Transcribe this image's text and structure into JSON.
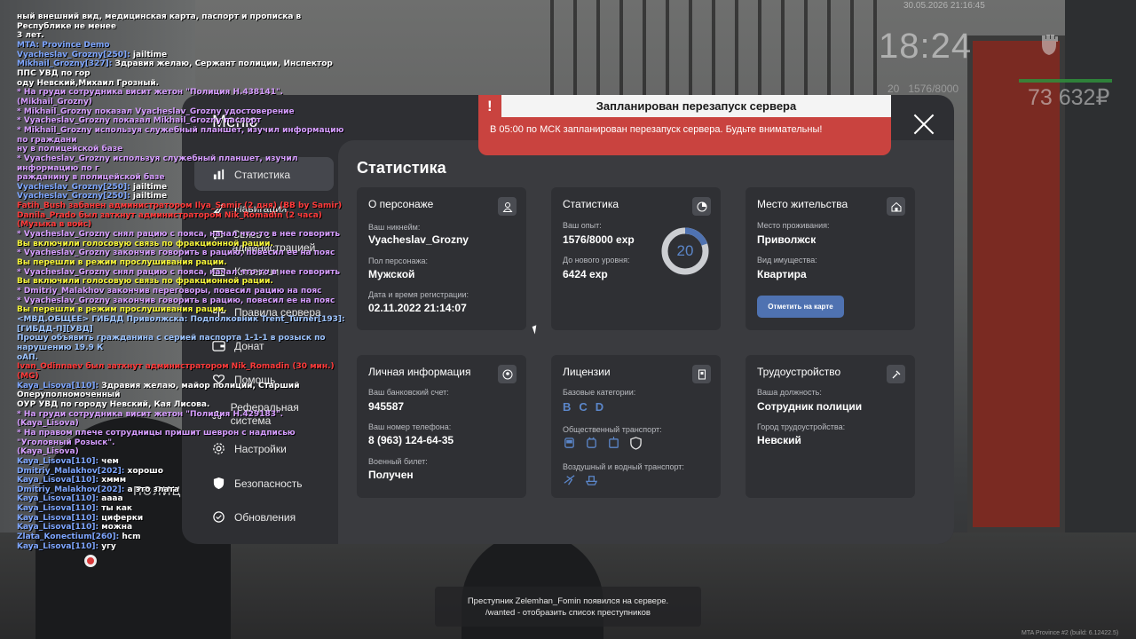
{
  "hud": {
    "date": "30.05.2026 21:16:45",
    "time": "18:24",
    "level": "20",
    "exp": "1576/8000",
    "money": "73 632₽"
  },
  "chat": [
    {
      "text": "ный внешний вид, медицинская карта, паспорт и прописка в Республике не менее",
      "color": "w"
    },
    {
      "text": "3 лет.",
      "color": "w"
    },
    {
      "text": "MTA: Province Demo",
      "color": "b"
    },
    {
      "text": "Vyacheslav_Grozny[250]: jailtime",
      "color": "b",
      "name": "Vyacheslav_Grozny[250]:",
      "msg": "jailtime"
    },
    {
      "text": "Mikhail_Grozny[327]: Здравия желаю, Сержант полиции, Инспектор ППС УВД по гор",
      "color": "b",
      "name": "Mikhail_Grozny[327]:",
      "msg": "Здравия желаю, Сержант полиции, Инспектор ППС УВД по гор"
    },
    {
      "text": "оду Невский,Михаил Грозный.",
      "color": "w"
    },
    {
      "text": "* На груди сотрудника висит жетон \"Полиция Н.438141\". (Mikhail_Grozny)",
      "color": "p"
    },
    {
      "text": "* Mikhail_Grozny показал Vyacheslav_Grozny удостоверение",
      "color": "p"
    },
    {
      "text": "* Vyacheslav_Grozny показал Mikhail_Grozny паспорт",
      "color": "p"
    },
    {
      "text": "* Mikhail_Grozny используя служебный планшет, изучил информацию по граждани",
      "color": "p"
    },
    {
      "text": "ну в полицейской базе",
      "color": "p"
    },
    {
      "text": "* Vyacheslav_Grozny используя служебный планшет, изучил информацию по г",
      "color": "p"
    },
    {
      "text": "ражданину в полицейской базе",
      "color": "p"
    },
    {
      "text": "Vyacheslav_Grozny[250]: jailtime",
      "color": "b",
      "name": "Vyacheslav_Grozny[250]:",
      "msg": "jailtime"
    },
    {
      "text": "Vyacheslav_Grozny[250]: jailtime",
      "color": "b",
      "name": "Vyacheslav_Grozny[250]:",
      "msg": "jailtime"
    },
    {
      "text": "Fatih_Bush забанен администратором Ilya_Samir (2 дня) (ВВ by Samir)",
      "color": "r"
    },
    {
      "text": "Danila_Prado был заткнут администратором Nik_Romadin (2 часа) (Музыка в войс)",
      "color": "r"
    },
    {
      "text": "* Vyacheslav_Grozny снял рацию с пояса, начал что-то в нее говорить",
      "color": "p"
    },
    {
      "text": "Вы включили голосовую связь по фракционной рации.",
      "color": "y"
    },
    {
      "text": "* Vyacheslav_Grozny закончив говорить в рацию, повесил ее на пояс",
      "color": "p"
    },
    {
      "text": "Вы перешли в режим прослушивания рации.",
      "color": "y"
    },
    {
      "text": "* Vyacheslav_Grozny снял рацию с пояса, начал что-то в нее говорить",
      "color": "p"
    },
    {
      "text": "Вы включили голосовую связь по фракционной рации.",
      "color": "y"
    },
    {
      "text": "* Dmitriy_Malakhov закончив переговоры, повесил рацию на пояс",
      "color": "p"
    },
    {
      "text": "* Vyacheslav_Grozny закончив говорить в рацию, повесил ее на пояс",
      "color": "p"
    },
    {
      "text": "Вы перешли в режим прослушивания рации.",
      "color": "y"
    },
    {
      "text": "<МВД.ОБЩЕЕ> ГИБДД Приволжска: Подполковник Trent_Turner[193]: [ГИБДД-П][УВД]",
      "color": "lb"
    },
    {
      "text": " Прошу объявить гражданина с серией паспорта 1-1-1 в розыск по нарушению 19.9 К",
      "color": "lb"
    },
    {
      "text": "оАП.",
      "color": "lb"
    },
    {
      "text": "Ivan_Odinnaev был заткнут администратором Nik_Romadin (30 мин.) (MG)",
      "color": "r"
    },
    {
      "text": "Kaya_Lisova[110]: Здравия желаю, майор полиции, Старший Оперуполномоченный",
      "color": "b",
      "name": "Kaya_Lisova[110]:",
      "msg": "Здравия желаю, майор полиции, Старший Оперуполномоченный"
    },
    {
      "text": " ОУР УВД по городу Невский, Кая Лисова.",
      "color": "w"
    },
    {
      "text": "* На груди сотрудника висит жетон \"Полиция Н.429183\". (Kaya_Lisova)",
      "color": "p"
    },
    {
      "text": "* На правом плече сотрудницы пришит шеврон с надписью \"Уголовный Розыск\".",
      "color": "p"
    },
    {
      "text": "(Kaya_Lisova)",
      "color": "p"
    },
    {
      "text": "Kaya_Lisova[110]: чем",
      "color": "b",
      "name": "Kaya_Lisova[110]:",
      "msg": "чем"
    },
    {
      "text": "Dmitriy_Malakhov[202]: хорошо",
      "color": "b",
      "name": "Dmitriy_Malakhov[202]:",
      "msg": "хорошо"
    },
    {
      "text": "Kaya_Lisova[110]: хммм",
      "color": "b",
      "name": "Kaya_Lisova[110]:",
      "msg": "хммм"
    },
    {
      "text": "Dmitriy_Malakhov[202]: а это злата",
      "color": "b",
      "name": "Dmitriy_Malakhov[202]:",
      "msg": "а это злата"
    },
    {
      "text": "Kaya_Lisova[110]: аааа",
      "color": "b",
      "name": "Kaya_Lisova[110]:",
      "msg": "аааа"
    },
    {
      "text": "Kaya_Lisova[110]: ты как",
      "color": "b",
      "name": "Kaya_Lisova[110]:",
      "msg": "ты как"
    },
    {
      "text": "Kaya_Lisova[110]: циферки",
      "color": "b",
      "name": "Kaya_Lisova[110]:",
      "msg": "циферки"
    },
    {
      "text": "Kaya_Lisova[110]: можна",
      "color": "b",
      "name": "Kaya_Lisova[110]:",
      "msg": "можна"
    },
    {
      "text": "Zlata_Konectium[260]: hcm",
      "color": "b",
      "name": "Zlata_Konectium[260]:",
      "msg": "hcm"
    },
    {
      "text": "Kaya_Lisova[110]: угу",
      "color": "b",
      "name": "Kaya_Lisova[110]:",
      "msg": "угу"
    }
  ],
  "menu": {
    "title": "Меню",
    "nav": [
      {
        "label": "Статистика",
        "icon": "chart-icon",
        "active": true
      },
      {
        "label": "Навигация",
        "icon": "compass-icon"
      },
      {
        "label": "Связь с администрацией",
        "icon": "chat-icon"
      },
      {
        "label": "Клавиши",
        "icon": "keyboard-icon"
      },
      {
        "label": "Правила сервера",
        "icon": "scales-icon"
      },
      {
        "label": "Донат",
        "icon": "wallet-icon"
      },
      {
        "label": "Помощь",
        "icon": "heart-hand-icon"
      },
      {
        "label": "Реферальная система",
        "icon": "referral-icon"
      },
      {
        "label": "Настройки",
        "icon": "gear-icon"
      },
      {
        "label": "Безопасность",
        "icon": "shield-icon"
      },
      {
        "label": "Обновления",
        "icon": "update-icon"
      }
    ]
  },
  "stats": {
    "title": "Статистика",
    "character": {
      "title": "О персонаже",
      "nick_label": "Ваш никнейм:",
      "nick": "Vyacheslav_Grozny",
      "gender_label": "Пол персонажа:",
      "gender": "Мужской",
      "reg_label": "Дата и время регистрации:",
      "reg": "02.11.2022 21:14:07"
    },
    "statistics": {
      "title": "Статистика",
      "exp_label": "Ваш опыт:",
      "exp": "1576/8000 exp",
      "next_label": "До нового уровня:",
      "next": "6424 exp",
      "level": "20",
      "progress": 0.197
    },
    "residence": {
      "title": "Место жительства",
      "place_label": "Место проживания:",
      "place": "Приволжск",
      "property_label": "Вид имущества:",
      "property": "Квартира",
      "map_button": "Отметить на карте"
    },
    "personal": {
      "title": "Личная информация",
      "bank_label": "Ваш банковский счет:",
      "bank": "945587",
      "phone_label": "Ваш номер телефона:",
      "phone": "8 (963) 124-64-35",
      "military_label": "Военный билет:",
      "military": "Получен"
    },
    "licenses": {
      "title": "Лицензии",
      "base_label": "Базовые категории:",
      "categories": [
        "B",
        "C",
        "D"
      ],
      "public_label": "Общественный транспорт:",
      "air_label": "Воздушный и водный транспорт:"
    },
    "employment": {
      "title": "Трудоустройство",
      "position_label": "Ваша должность:",
      "position": "Сотрудник полиции",
      "city_label": "Город трудоустройства:",
      "city": "Невский"
    }
  },
  "notification": {
    "title": "Запланирован перезапуск сервера",
    "mark": "!",
    "text": "В 05:00 по МСК запланирован перезапуск сервера. Будьте внимательны!"
  },
  "bottom_message": {
    "line1": "Преступник Zelemhan_Fomin появился на сервере.",
    "line2": "/wanted - отобразить список преступников"
  },
  "build": "MTA Province #2 (build: 6.12422.5)",
  "background": {
    "police_text": "ПОЛИЦ"
  }
}
